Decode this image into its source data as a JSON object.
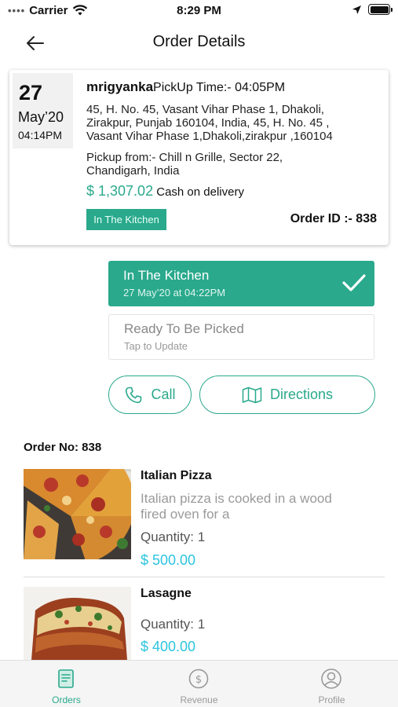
{
  "status_bar": {
    "carrier": "Carrier",
    "time": "8:29 PM"
  },
  "nav": {
    "title": "Order Details"
  },
  "order": {
    "date_day": "27",
    "date_month": "May’20",
    "date_time": "04:14PM",
    "customer_name": "mrigyanka",
    "pickup_time": "PickUp Time:- 04:05PM",
    "address_line_1": "45, H. No. 45, Vasant Vihar Phase 1, Dhakoli,",
    "address_line_2": "Zirakpur, Punjab 160104, India, 45, H. No. 45 ,",
    "address_line_3": "Vasant Vihar Phase 1,Dhakoli,zirakpur ,160104",
    "pickup_from_line_1": "Pickup from:- Chill n Grille, Sector 22,",
    "pickup_from_line_2": "Chandigarh, India",
    "price": "$ 1,307.02",
    "payment": "Cash on delivery",
    "status_badge": "In The Kitchen",
    "order_id": "Order ID :- 838"
  },
  "steps": {
    "current": {
      "title": "In The Kitchen",
      "subtitle": "27 May’20 at 04:22PM"
    },
    "next": {
      "title": "Ready To Be Picked",
      "subtitle": "Tap to Update"
    }
  },
  "actions": {
    "call": "Call",
    "directions": "Directions"
  },
  "order_no": "Order No: 838",
  "items": [
    {
      "name": "Italian Pizza",
      "desc_line_1": "Italian pizza is cooked in a wood",
      "desc_line_2": "fired oven for a",
      "quantity": "Quantity: 1",
      "price": "$ 500.00"
    },
    {
      "name": "Lasagne",
      "quantity": "Quantity: 1",
      "price": "$ 400.00"
    }
  ],
  "tabs": [
    {
      "label": "Orders",
      "icon": "orders-icon",
      "active": true
    },
    {
      "label": "Revenue",
      "icon": "revenue-icon",
      "active": false
    },
    {
      "label": "Profile",
      "icon": "profile-icon",
      "active": false
    }
  ],
  "colors": {
    "accent": "#2aa98c",
    "price_blue": "#2bc4de"
  }
}
